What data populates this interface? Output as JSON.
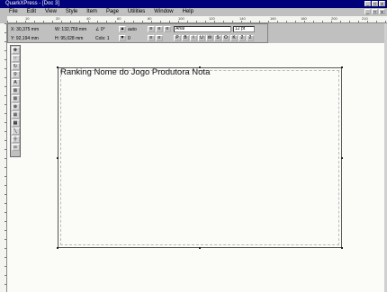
{
  "window": {
    "title": "QuarkXPress - [Doc 3]",
    "controls": [
      "_",
      "□",
      "x"
    ]
  },
  "menu": [
    "File",
    "Edit",
    "View",
    "Style",
    "Item",
    "Page",
    "Utilities",
    "Window",
    "Help"
  ],
  "ruler": {
    "labels": [
      "10",
      "20",
      "40",
      "60",
      "80",
      "100",
      "120",
      "140",
      "160",
      "180",
      "200",
      "210"
    ]
  },
  "measurements": {
    "x": "X: 30,375 mm",
    "y": "Y: 92,194 mm",
    "w": "W: 132,759 mm",
    "h": "H: 95,028 mm",
    "angle": "∠ 0°",
    "cols": "Cols: 1",
    "leading": "auto",
    "tracking": "0",
    "font": "Arial",
    "size": "12 pt"
  },
  "tools": [
    "arrow",
    "move",
    "text",
    "rotate",
    "zoom",
    "rect-box",
    "rounded-box",
    "oval-box",
    "poly-box",
    "line",
    "ortho-line",
    "link",
    "unlink"
  ],
  "document": {
    "headline": "Ranking Nome do Jogo Produtora Nota"
  }
}
